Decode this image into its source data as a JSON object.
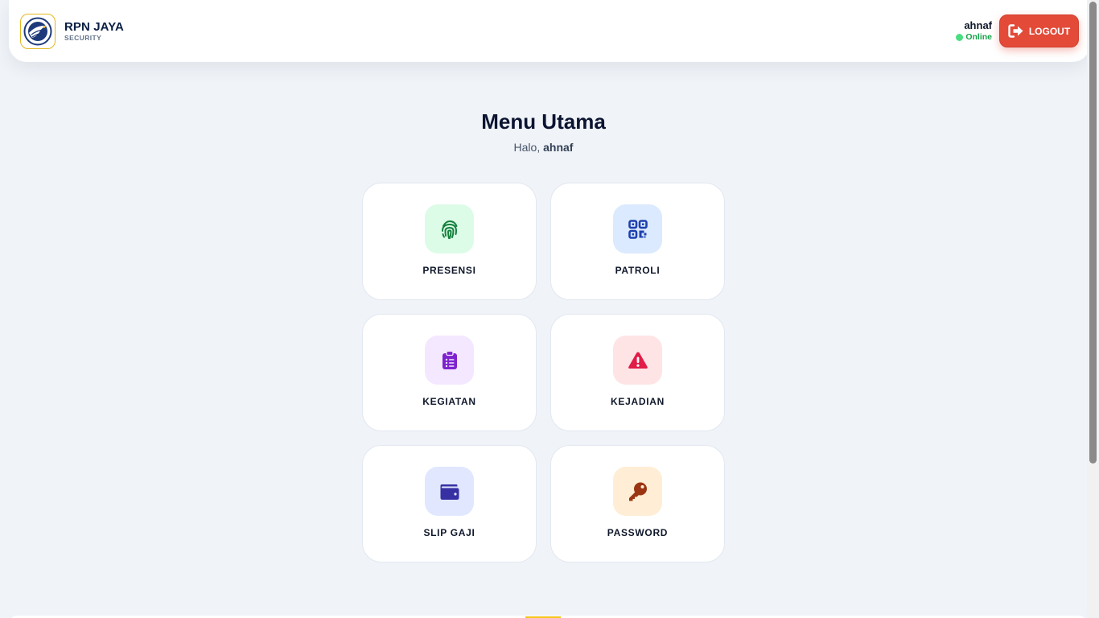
{
  "header": {
    "brand_title": "RPN JAYA",
    "brand_subtitle": "SECURITY",
    "user_name": "ahnaf",
    "user_status": "Online",
    "logout_label": "LOGOUT",
    "logout_icon": "sign-out-icon"
  },
  "main": {
    "title": "Menu Utama",
    "greeting_prefix": "Halo, ",
    "greeting_name": "ahnaf"
  },
  "menu": [
    {
      "label": "PRESENSI",
      "icon": "fingerprint-icon",
      "bg": "#dcfce7",
      "color": "#15803d"
    },
    {
      "label": "PATROLI",
      "icon": "qrcode-icon",
      "bg": "#dbeafe",
      "color": "#1e40af"
    },
    {
      "label": "KEGIATAN",
      "icon": "clipboard-list-icon",
      "bg": "#f3e8ff",
      "color": "#7e22ce"
    },
    {
      "label": "KEJADIAN",
      "icon": "warning-triangle-icon",
      "bg": "#ffe4e6",
      "color": "#e11d48"
    },
    {
      "label": "SLIP GAJI",
      "icon": "wallet-icon",
      "bg": "#e0e7ff",
      "color": "#3730a3"
    },
    {
      "label": "PASSWORD",
      "icon": "key-icon",
      "bg": "#ffedd5",
      "color": "#9a3412"
    }
  ],
  "colors": {
    "page_bg": "#f0f3f8",
    "logout_bg": "#e34a38",
    "online": "#16a34a",
    "accent_gold": "#f5c518"
  }
}
